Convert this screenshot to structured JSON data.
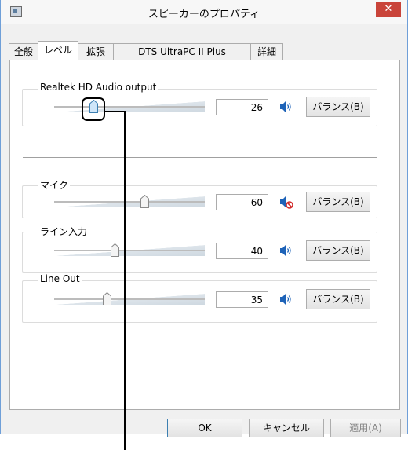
{
  "window": {
    "title": "スピーカーのプロパティ",
    "close_glyph": "✕"
  },
  "tabs": [
    {
      "label": "全般"
    },
    {
      "label": "レベル",
      "active": true
    },
    {
      "label": "拡張"
    },
    {
      "label": "DTS UltraPC II Plus"
    },
    {
      "label": "詳細"
    }
  ],
  "devices": [
    {
      "name": "Realtek HD Audio output",
      "value": "26",
      "level": 0.26,
      "muted": false,
      "balance_label": "バランス(B)"
    },
    {
      "name": "マイク",
      "value": "60",
      "level": 0.6,
      "muted": true,
      "balance_label": "バランス(B)"
    },
    {
      "name": "ライン入力",
      "value": "40",
      "level": 0.4,
      "muted": false,
      "balance_label": "バランス(B)"
    },
    {
      "name": "Line Out",
      "value": "35",
      "level": 0.35,
      "muted": false,
      "balance_label": "バランス(B)"
    }
  ],
  "footer": {
    "ok_label": "OK",
    "cancel_label": "キャンセル",
    "apply_label": "適用(A)"
  },
  "icons": {
    "speaker": "speaker-icon",
    "muted_speaker": "speaker-muted-icon",
    "app": "speaker-properties-icon"
  },
  "colors": {
    "close_button": "#c9443a",
    "speaker_blue": "#1e63b8",
    "mute_red": "#d12b2b"
  }
}
